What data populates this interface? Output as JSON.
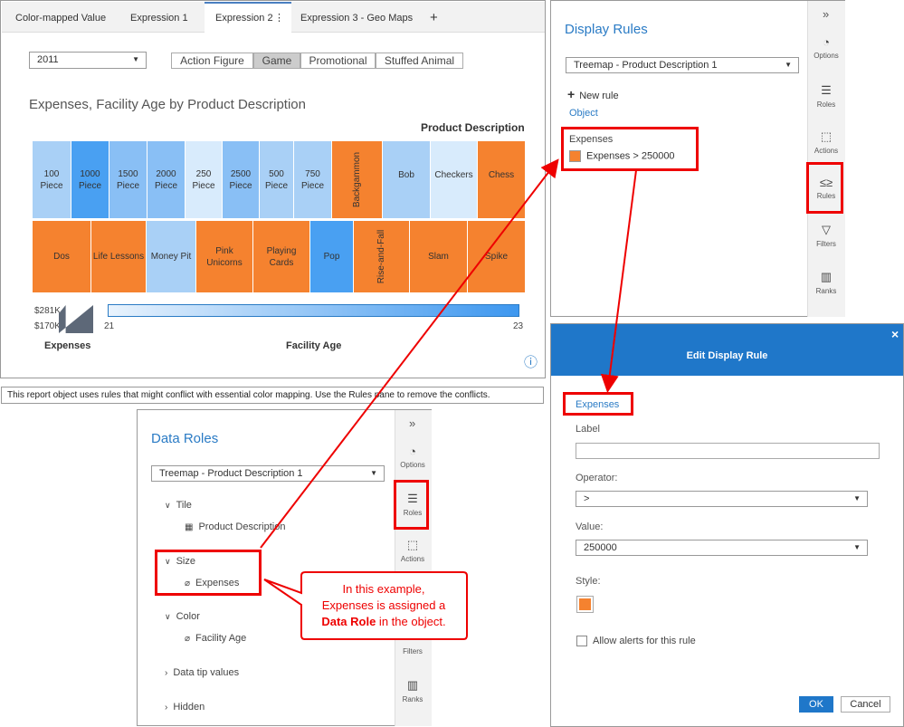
{
  "report": {
    "tabs": [
      "Color-mapped Value",
      "Expression 1",
      "Expression 2",
      "Expression 3 - Geo Maps"
    ],
    "tab_menu": "⋮",
    "add_tab": "+",
    "year_select": "2011",
    "buttons": [
      "Action Figure",
      "Game",
      "Promotional",
      "Stuffed Animal"
    ],
    "chart_title": "Expenses, Facility Age by Product Description",
    "legend_title": "Product Description",
    "tiles_row1": [
      "100 Piece",
      "1000 Piece",
      "1500 Piece",
      "2000 Piece",
      "250 Piece",
      "2500 Piece",
      "500 Piece",
      "750 Piece",
      "Backgammon",
      "Bob",
      "Checkers",
      "Chess"
    ],
    "tiles_row2": [
      "Dos",
      "Life Lessons",
      "Money Pit",
      "Pink Unicorns",
      "Playing Cards",
      "Pop",
      "Rise-and-Fall",
      "Slam",
      "Spike"
    ],
    "size_max": "$281K",
    "size_min": "$170K",
    "size_label": "Expenses",
    "gradient_min": "21",
    "gradient_max": "23",
    "gradient_label": "Facility Age",
    "info_icon": "ⓘ"
  },
  "warning": "This report object uses rules that might conflict with essential color mapping. Use the Rules pane to remove the conflicts.",
  "display_rules": {
    "title": "Display Rules",
    "collapse": "»",
    "object_select": "Treemap - Product Description 1",
    "new_rule": "New rule",
    "object_link": "Object",
    "rule_group": "Expenses",
    "rule_text": "Expenses > 250000",
    "side": [
      "Options",
      "Roles",
      "Actions",
      "Rules",
      "Filters",
      "Ranks"
    ]
  },
  "data_roles": {
    "title": "Data Roles",
    "collapse": "»",
    "object_select": "Treemap - Product Description 1",
    "tile": "Tile",
    "tile_item": "Product Description",
    "size": "Size",
    "size_item": "Expenses",
    "color": "Color",
    "color_item": "Facility Age",
    "datatip": "Data tip values",
    "hidden": "Hidden",
    "side": [
      "Options",
      "Roles",
      "Actions",
      "Filters",
      "Ranks"
    ]
  },
  "callout": {
    "line1": "In this example,",
    "line2": "Expenses is assigned a",
    "bold": "Data Role",
    "tail": " in the object."
  },
  "edit_rule": {
    "title": "Edit Display Rule",
    "close": "×",
    "field": "Expenses",
    "label_label": "Label",
    "label_value": "",
    "operator_label": "Operator:",
    "operator_value": ">",
    "value_label": "Value:",
    "value_value": "250000",
    "style_label": "Style:",
    "allow_alerts": "Allow alerts for this rule",
    "ok": "OK",
    "cancel": "Cancel"
  },
  "colors": {
    "accent": "#2a7bc5",
    "highlight": "#f5822f",
    "callout": "#e00000",
    "dialog_header": "#1f77c9"
  }
}
